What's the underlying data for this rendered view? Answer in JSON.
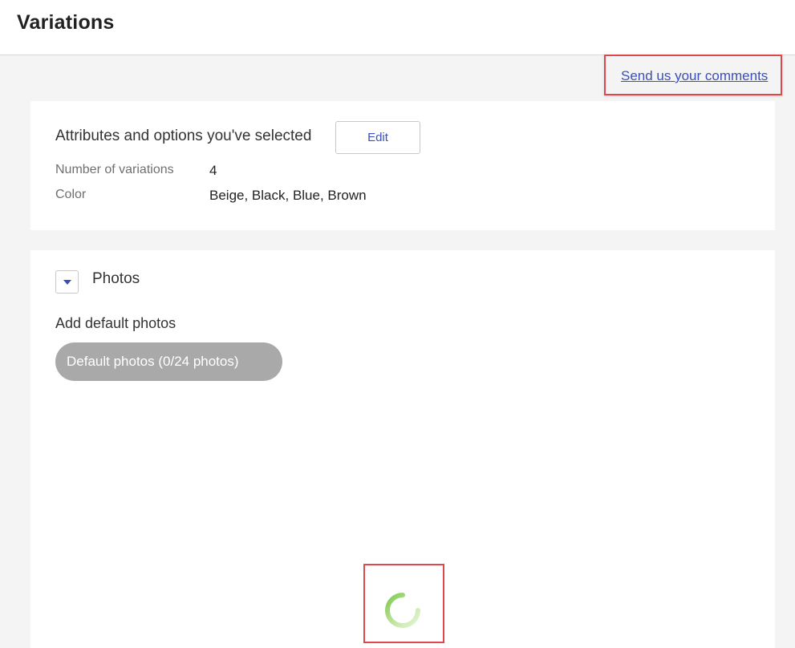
{
  "header": {
    "title": "Variations"
  },
  "feedback": {
    "link_label": "Send us your comments"
  },
  "attributes_card": {
    "heading": "Attributes and options you've selected",
    "edit_label": "Edit",
    "rows": [
      {
        "label": "Number of variations",
        "value": "4"
      },
      {
        "label": "Color",
        "value": "Beige, Black, Blue, Brown"
      }
    ]
  },
  "photos_card": {
    "heading": "Photos",
    "toggle_icon": "caret-down-icon",
    "default_label": "Add default photos",
    "default_button_label": "Default photos (0/24 photos)"
  },
  "loading": {
    "icon": "loading-spinner-icon"
  },
  "colors": {
    "link": "#3b4fb8",
    "highlight": "#e0474c",
    "spinner": "#7cc84a",
    "disabled_button": "#a9a9a9"
  }
}
